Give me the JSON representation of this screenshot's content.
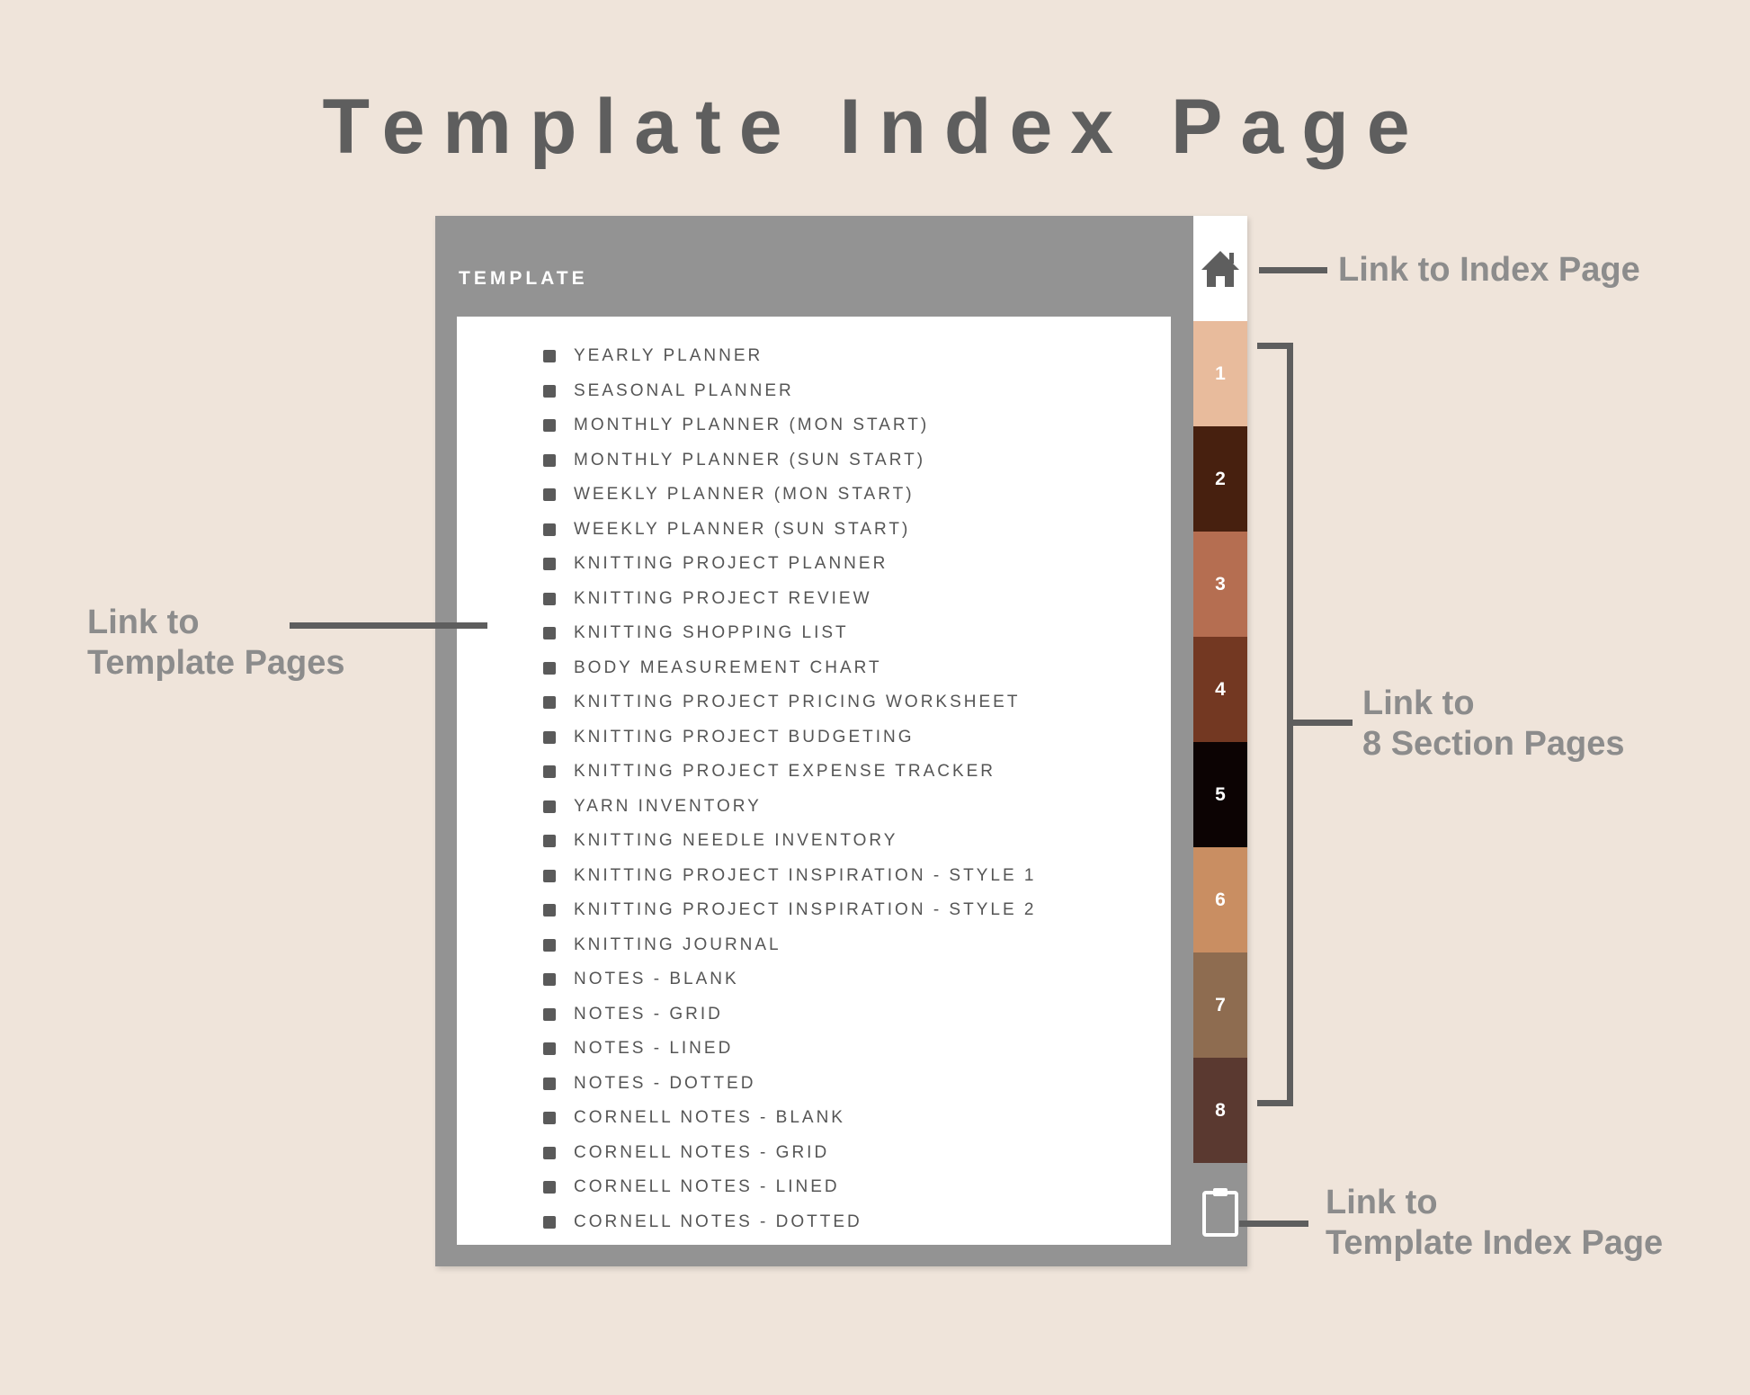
{
  "title": "Template Index Page",
  "panel": {
    "header": "TEMPLATE",
    "items": [
      "YEARLY PLANNER",
      "SEASONAL PLANNER",
      "MONTHLY PLANNER (MON START)",
      "MONTHLY PLANNER (SUN START)",
      "WEEKLY PLANNER (MON START)",
      "WEEKLY PLANNER (SUN START)",
      "KNITTING PROJECT PLANNER",
      "KNITTING PROJECT REVIEW",
      "KNITTING SHOPPING LIST",
      "BODY MEASUREMENT CHART",
      "KNITTING PROJECT PRICING WORKSHEET",
      "KNITTING PROJECT BUDGETING",
      "KNITTING PROJECT EXPENSE TRACKER",
      "YARN INVENTORY",
      "KNITTING NEEDLE INVENTORY",
      "KNITTING PROJECT INSPIRATION - STYLE 1",
      "KNITTING PROJECT INSPIRATION - STYLE 2",
      "KNITTING JOURNAL",
      "NOTES - BLANK",
      "NOTES - GRID",
      "NOTES - LINED",
      "NOTES - DOTTED",
      "CORNELL NOTES - BLANK",
      "CORNELL NOTES - GRID",
      "CORNELL NOTES - LINED",
      "CORNELL NOTES - DOTTED"
    ]
  },
  "sidebar": {
    "home_icon": "home-icon",
    "clipboard_icon": "clipboard-icon",
    "tabs": [
      {
        "label": "1",
        "color": "#E8BB9C"
      },
      {
        "label": "2",
        "color": "#47200F"
      },
      {
        "label": "3",
        "color": "#B56E51"
      },
      {
        "label": "4",
        "color": "#733822"
      },
      {
        "label": "5",
        "color": "#0C0303"
      },
      {
        "label": "6",
        "color": "#C98E62"
      },
      {
        "label": "7",
        "color": "#8E6C50"
      },
      {
        "label": "8",
        "color": "#5A3930"
      }
    ]
  },
  "callouts": {
    "index": "Link to Index Page",
    "sections_line1": "Link to",
    "sections_line2": "8 Section Pages",
    "template_pages_line1": "Link to",
    "template_pages_line2": "Template Pages",
    "template_index_line1": "Link to",
    "template_index_line2": "Template Index Page"
  }
}
